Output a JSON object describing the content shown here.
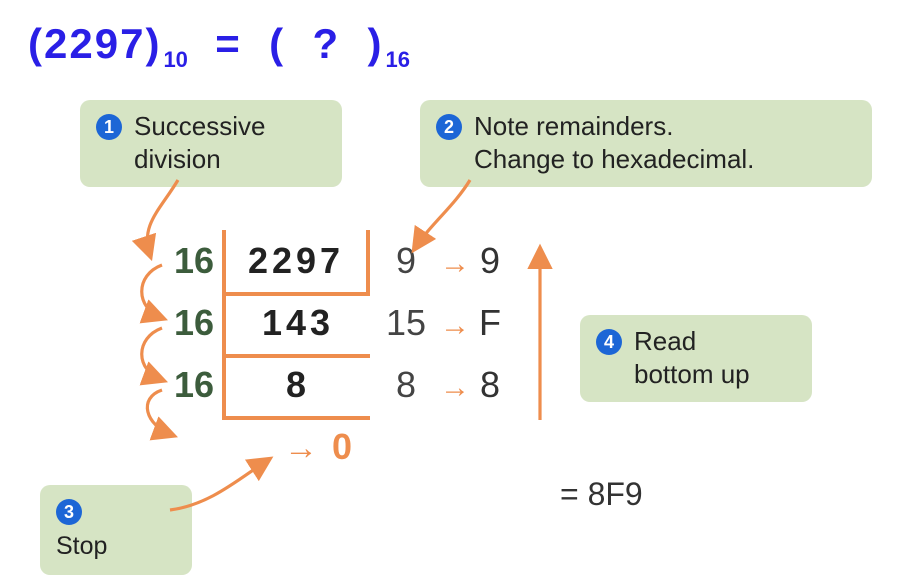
{
  "equation": {
    "left_paren_open": "(",
    "decimal_value": "2297",
    "left_paren_close": ")",
    "src_base": "10",
    "equals": "=",
    "right_paren_open": "(",
    "unknown": "?",
    "right_paren_close": ")",
    "target_base": "16"
  },
  "callouts": {
    "c1": {
      "num": "1",
      "line1": "Successive",
      "line2": "division"
    },
    "c2": {
      "num": "2",
      "line1": "Note remainders.",
      "line2": "Change to hexadecimal."
    },
    "c3": {
      "num": "3",
      "line1": "Stop"
    },
    "c4": {
      "num": "4",
      "line1": "Read",
      "line2": "bottom up"
    }
  },
  "division": {
    "rows": [
      {
        "divisor": "16",
        "dividend": "2297",
        "remainder": "9",
        "hex": "9"
      },
      {
        "divisor": "16",
        "dividend": "143",
        "remainder": "15",
        "hex": "F"
      },
      {
        "divisor": "16",
        "dividend": "8",
        "remainder": "8",
        "hex": "8"
      }
    ],
    "final": "0"
  },
  "result": {
    "prefix": "= ",
    "value": "8F9"
  },
  "colors": {
    "accent_blue": "#2a1fe6",
    "callout_bg": "#d6e4c4",
    "badge": "#1c66d6",
    "orange": "#ee8d4d",
    "green_text": "#3c5c3c"
  }
}
